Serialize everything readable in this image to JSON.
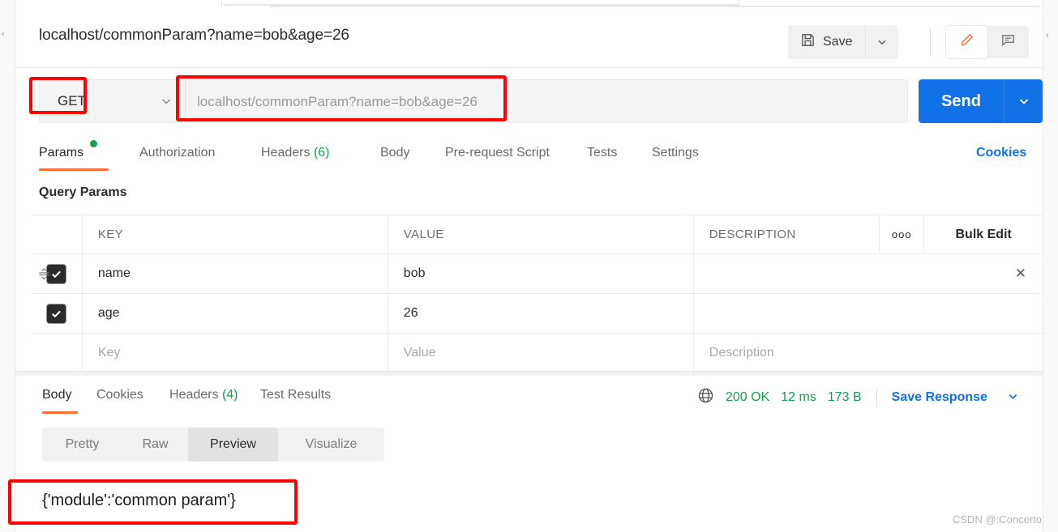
{
  "request": {
    "title": "localhost/commonParam?name=bob&age=26",
    "method": "GET",
    "url_placeholder": "localhost/commonParam?name=bob&age=26",
    "save_label": "Save",
    "send_label": "Send"
  },
  "request_tabs": [
    {
      "label": "Params",
      "badge": "",
      "dot": true,
      "active": true
    },
    {
      "label": "Authorization",
      "badge": "",
      "dot": false,
      "active": false
    },
    {
      "label": "Headers",
      "badge": "(6)",
      "dot": false,
      "active": false
    },
    {
      "label": "Body",
      "badge": "",
      "dot": false,
      "active": false
    },
    {
      "label": "Pre-request Script",
      "badge": "",
      "dot": false,
      "active": false
    },
    {
      "label": "Tests",
      "badge": "",
      "dot": false,
      "active": false
    },
    {
      "label": "Settings",
      "badge": "",
      "dot": false,
      "active": false
    }
  ],
  "cookies_link": "Cookies",
  "params": {
    "section_title": "Query Params",
    "columns": [
      "KEY",
      "VALUE",
      "DESCRIPTION"
    ],
    "more_label": "ooo",
    "bulk_edit_label": "Bulk Edit",
    "rows": [
      {
        "checked": true,
        "key": "name",
        "value": "bob",
        "description": ""
      },
      {
        "checked": true,
        "key": "age",
        "value": "26",
        "description": ""
      }
    ],
    "empty_row": {
      "key_placeholder": "Key",
      "value_placeholder": "Value",
      "description_placeholder": "Description"
    }
  },
  "response_tabs": [
    {
      "label": "Body",
      "badge": "",
      "active": true
    },
    {
      "label": "Cookies",
      "badge": "",
      "active": false
    },
    {
      "label": "Headers",
      "badge": "(4)",
      "active": false
    },
    {
      "label": "Test Results",
      "badge": "",
      "active": false
    }
  ],
  "response_status": {
    "status": "200 OK",
    "time": "12 ms",
    "size": "173 B",
    "save_response_label": "Save Response"
  },
  "body_view_modes": [
    {
      "label": "Pretty",
      "active": false
    },
    {
      "label": "Raw",
      "active": false
    },
    {
      "label": "Preview",
      "active": true
    },
    {
      "label": "Visualize",
      "active": false
    }
  ],
  "response_body": "{'module':'common param'}",
  "watermark": "CSDN @:Concerto",
  "colors": {
    "accent_orange": "#ff6c37",
    "send_blue": "#1172e8",
    "status_green": "#15a052",
    "annotation_red": "#fe0000"
  }
}
